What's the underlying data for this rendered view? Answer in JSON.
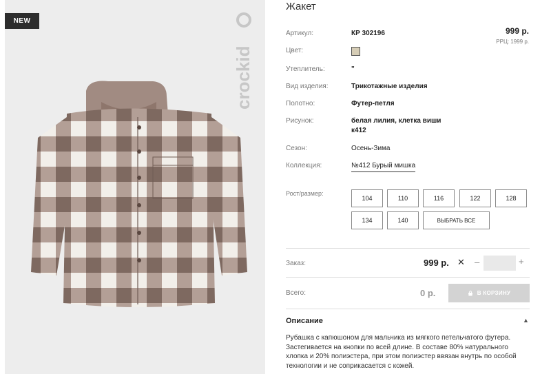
{
  "badge": "NEW",
  "brand": "crockid",
  "product": {
    "title": "Жакет",
    "price": "999 р.",
    "rrp": "РРЦ: 1999 р.",
    "color_swatch": "#d6cdb6"
  },
  "attributes": [
    {
      "label": "Артикул:",
      "value": "КР 302196",
      "bold": true
    },
    {
      "label": "Цвет:",
      "value": ""
    },
    {
      "label": "Утеплитель:",
      "value": "\"",
      "bold": true
    },
    {
      "label": "Вид изделия:",
      "value": "Трикотажные изделия",
      "bold": true
    },
    {
      "label": "Полотно:",
      "value": "Футер-петля",
      "bold": true
    },
    {
      "label": "Рисунок:",
      "value_line1": "белая лилия, клетка виши",
      "value_line2": "к412",
      "bold": true
    },
    {
      "label": "Сезон:",
      "value": "Осень-Зима"
    },
    {
      "label": "Коллекция:",
      "value": "№412 Бурый мишка"
    }
  ],
  "sizes": {
    "label": "Рост/размер:",
    "options": [
      "104",
      "110",
      "116",
      "122",
      "128",
      "134",
      "140"
    ],
    "select_all": "ВЫБРАТЬ ВСЕ"
  },
  "order": {
    "label": "Заказ:",
    "price": "999 р.",
    "times": "✕",
    "minus": "–",
    "plus": "+",
    "quantity": ""
  },
  "total": {
    "label": "Всего:",
    "value": "0 р.",
    "cart_button": "В КОРЗИНУ"
  },
  "description": {
    "title": "Описание",
    "text": "Рубашка с капюшоном для мальчика из мягкого петельчатого футера. Застегивается на кнопки по всей длине. В составе 80% натурального хлопка и 20% полиэстера, при этом полиэстер ввязан внутрь по особой технологии и не соприкасается с кожей."
  },
  "colors": {
    "check_dark": "#8f7a70",
    "check_light": "#f2efea",
    "hood": "#a18b82",
    "badge_bg": "#2d2d2d",
    "cart_button_bg": "#d3d3d3"
  }
}
